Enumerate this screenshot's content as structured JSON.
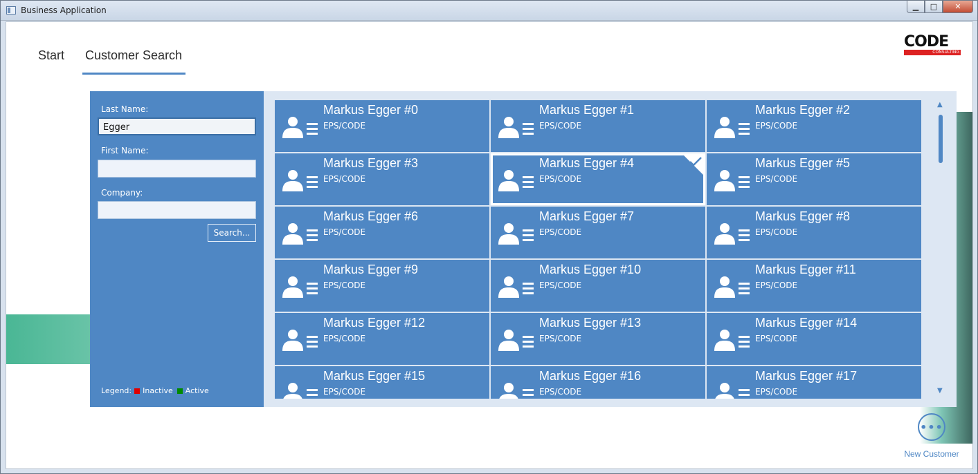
{
  "window": {
    "title": "Business Application"
  },
  "tabs": [
    {
      "label": "Start",
      "active": false
    },
    {
      "label": "Customer Search",
      "active": true
    }
  ],
  "logo": {
    "text": "CODE",
    "subtext": "CONSULTING"
  },
  "search": {
    "last_name_label": "Last Name:",
    "last_name_value": "Egger",
    "first_name_label": "First Name:",
    "first_name_value": "",
    "company_label": "Company:",
    "company_value": "",
    "search_button": "Search..."
  },
  "legend": {
    "label": "Legend:",
    "items": [
      {
        "label": "Inactive",
        "color": "#e00000"
      },
      {
        "label": "Active",
        "color": "#008a00"
      }
    ]
  },
  "results": [
    {
      "name": "Markus Egger #0",
      "company": "EPS/CODE"
    },
    {
      "name": "Markus Egger #1",
      "company": "EPS/CODE"
    },
    {
      "name": "Markus Egger #2",
      "company": "EPS/CODE"
    },
    {
      "name": "Markus Egger #3",
      "company": "EPS/CODE"
    },
    {
      "name": "Markus Egger #4",
      "company": "EPS/CODE",
      "selected": true
    },
    {
      "name": "Markus Egger #5",
      "company": "EPS/CODE"
    },
    {
      "name": "Markus Egger #6",
      "company": "EPS/CODE"
    },
    {
      "name": "Markus Egger #7",
      "company": "EPS/CODE"
    },
    {
      "name": "Markus Egger #8",
      "company": "EPS/CODE"
    },
    {
      "name": "Markus Egger #9",
      "company": "EPS/CODE"
    },
    {
      "name": "Markus Egger #10",
      "company": "EPS/CODE"
    },
    {
      "name": "Markus Egger #11",
      "company": "EPS/CODE"
    },
    {
      "name": "Markus Egger #12",
      "company": "EPS/CODE"
    },
    {
      "name": "Markus Egger #13",
      "company": "EPS/CODE"
    },
    {
      "name": "Markus Egger #14",
      "company": "EPS/CODE"
    },
    {
      "name": "Markus Egger #15",
      "company": "EPS/CODE"
    },
    {
      "name": "Markus Egger #16",
      "company": "EPS/CODE"
    },
    {
      "name": "Markus Egger #17",
      "company": "EPS/CODE"
    }
  ],
  "new_customer": {
    "label": "New Customer",
    "icon": "more-icon",
    "glyph": "•••"
  },
  "colors": {
    "accent": "#4f87c4",
    "results_bg": "#dde7f3"
  }
}
